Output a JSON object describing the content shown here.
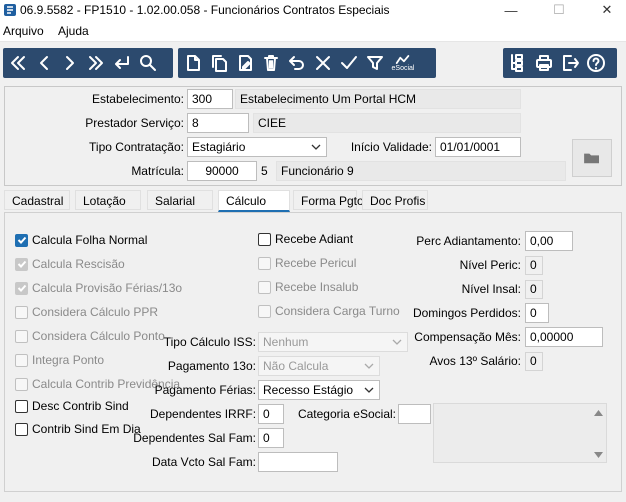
{
  "window": {
    "title": "06.9.5582 - FP1510 - 1.02.00.058 - Funcionários Contratos Especiais",
    "minimize": "—",
    "maximize": "☐",
    "close": "✕"
  },
  "menu": [
    "Arquivo",
    "Ajuda"
  ],
  "toolbar": {
    "nav": [
      "first-icon",
      "prev-icon",
      "next-icon",
      "last-icon",
      "enter-icon",
      "search-icon"
    ],
    "edit": [
      "new-icon",
      "copy-icon",
      "edit-icon",
      "delete-icon",
      "undo-icon",
      "cancel-icon",
      "confirm-icon",
      "filter-icon",
      "esocial-icon"
    ],
    "esocial_label": "eSocial",
    "right": [
      "tree-icon",
      "print-icon",
      "exit-icon",
      "help-icon"
    ]
  },
  "header": {
    "estabelecimento_label": "Estabelecimento:",
    "estabelecimento_code": "300",
    "estabelecimento_name": "Estabelecimento Um Portal HCM",
    "prestador_label": "Prestador Serviço:",
    "prestador_code": "8",
    "prestador_name": "CIEE",
    "tipo_contratacao_label": "Tipo Contratação:",
    "tipo_contratacao_value": "Estagiário",
    "inicio_validade_label": "Início Validade:",
    "inicio_validade_value": "01/01/0001",
    "matricula_label": "Matrícula:",
    "matricula_value": "90000",
    "matricula_digit": "5",
    "funcionario_name": "Funcionário 9"
  },
  "tabs": [
    "Cadastral",
    "Lotação",
    "Salarial",
    "Cálculo",
    "Forma Pgto",
    "Doc Profis"
  ],
  "active_tab": "Cálculo",
  "calculo": {
    "col1": [
      {
        "label": "Calcula Folha Normal",
        "checked": true,
        "disabled": false
      },
      {
        "label": "Calcula Rescisão",
        "checked": true,
        "disabled": true
      },
      {
        "label": "Calcula Provisão Férias/13o",
        "checked": true,
        "disabled": true
      },
      {
        "label": "Considera Cálculo PPR",
        "checked": false,
        "disabled": true
      },
      {
        "label": "Considera Cálculo Ponto",
        "checked": false,
        "disabled": true
      },
      {
        "label": "Integra Ponto",
        "checked": false,
        "disabled": true
      },
      {
        "label": "Calcula Contrib Previdência",
        "checked": false,
        "disabled": true
      },
      {
        "label": "Desc Contrib Sind",
        "checked": false,
        "disabled": false
      },
      {
        "label": "Contrib Sind Em Dia",
        "checked": false,
        "disabled": false
      }
    ],
    "col2": [
      {
        "label": "Recebe Adiant",
        "checked": false,
        "disabled": false
      },
      {
        "label": "Recebe Pericul",
        "checked": false,
        "disabled": true
      },
      {
        "label": "Recebe Insalub",
        "checked": false,
        "disabled": true
      },
      {
        "label": "Considera Carga Turno",
        "checked": false,
        "disabled": true
      }
    ],
    "tipo_calculo_iss_label": "Tipo Cálculo ISS:",
    "tipo_calculo_iss_value": "Nenhum",
    "pagamento_13_label": "Pagamento 13o:",
    "pagamento_13_value": "Não Calcula",
    "pagamento_ferias_label": "Pagamento Férias:",
    "pagamento_ferias_value": "Recesso Estágio",
    "dependentes_irrf_label": "Dependentes IRRF:",
    "dependentes_irrf_value": "0",
    "categoria_esocial_label": "Categoria eSocial:",
    "categoria_esocial_value": "",
    "dependentes_sal_fam_label": "Dependentes Sal Fam:",
    "dependentes_sal_fam_value": "0",
    "data_vcto_sal_fam_label": "Data Vcto Sal Fam:",
    "data_vcto_sal_fam_value": "",
    "perc_adiantamento_label": "Perc Adiantamento:",
    "perc_adiantamento_value": "0,00",
    "nivel_peric_label": "Nível Peric:",
    "nivel_peric_value": "0",
    "nivel_insal_label": "Nível Insal:",
    "nivel_insal_value": "0",
    "domingos_perdidos_label": "Domingos Perdidos:",
    "domingos_perdidos_value": "0",
    "compensacao_mes_label": "Compensação Mês:",
    "compensacao_mes_value": "0,00000",
    "avos_13_label": "Avos 13º Salário:",
    "avos_13_value": "0"
  }
}
